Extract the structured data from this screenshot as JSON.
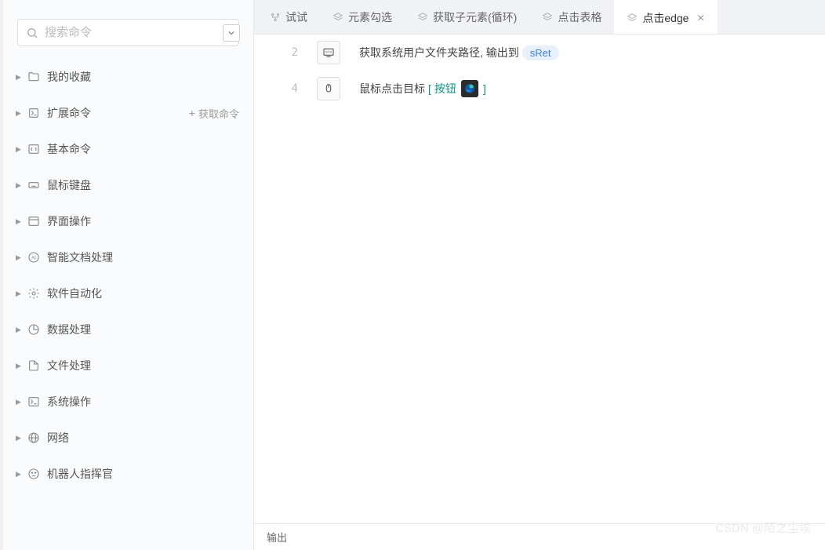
{
  "search": {
    "placeholder": "搜索命令"
  },
  "sidebar_action": "获取命令",
  "tree": [
    {
      "label": "我的收藏",
      "icon": "folder"
    },
    {
      "label": "扩展命令",
      "icon": "extension",
      "extra": true
    },
    {
      "label": "基本命令",
      "icon": "code"
    },
    {
      "label": "鼠标键盘",
      "icon": "keyboard"
    },
    {
      "label": "界面操作",
      "icon": "window"
    },
    {
      "label": "智能文档处理",
      "icon": "ai"
    },
    {
      "label": "软件自动化",
      "icon": "gear"
    },
    {
      "label": "数据处理",
      "icon": "chart"
    },
    {
      "label": "文件处理",
      "icon": "file"
    },
    {
      "label": "系统操作",
      "icon": "system"
    },
    {
      "label": "网络",
      "icon": "globe"
    },
    {
      "label": "机器人指挥官",
      "icon": "robot"
    }
  ],
  "tabs": [
    {
      "label": "试试",
      "icon": "flow",
      "active": false
    },
    {
      "label": "元素勾选",
      "icon": "stack",
      "active": false
    },
    {
      "label": "获取子元素(循环)",
      "icon": "stack",
      "active": false
    },
    {
      "label": "点击表格",
      "icon": "stack",
      "active": false
    },
    {
      "label": "点击edge",
      "icon": "stack",
      "active": true,
      "closeable": true
    }
  ],
  "rows": [
    {
      "n": "2",
      "icon": "sys",
      "text": "获取系统用户文件夹路径, 输出到",
      "pill": "sRet"
    },
    {
      "n": "4",
      "icon": "mouse",
      "text": "鼠标点击目标",
      "target": "按钮",
      "edge": true
    }
  ],
  "output_label": "输出",
  "watermark": "CSDN @陌之尘埃"
}
